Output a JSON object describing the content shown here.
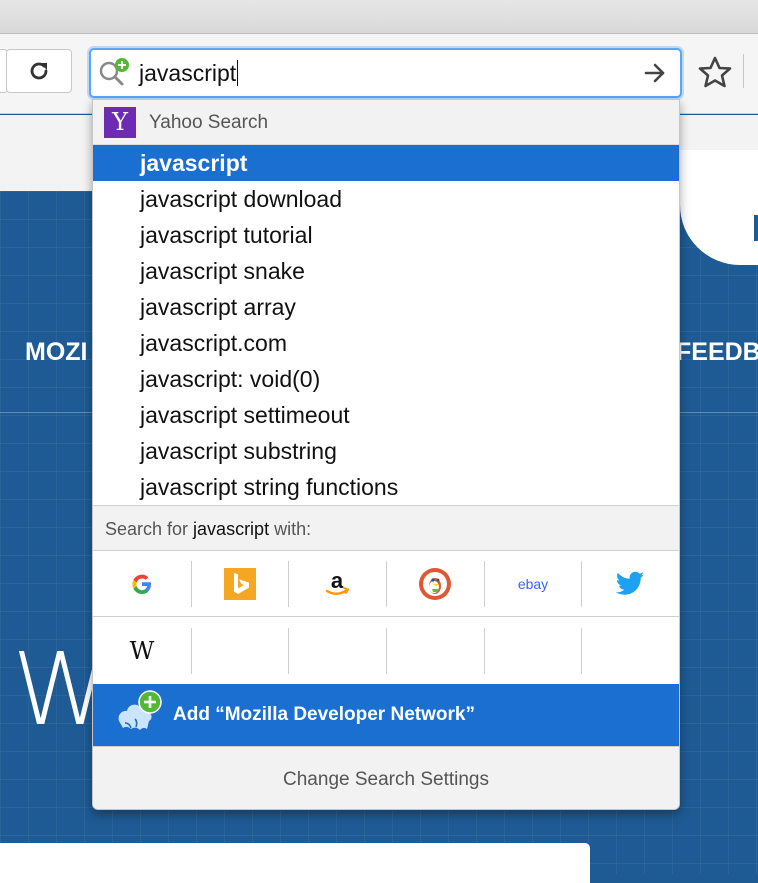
{
  "urlbar": {
    "value": "javascript"
  },
  "popup": {
    "engine_header": {
      "logo_text": "Y",
      "name": "Yahoo Search"
    },
    "suggestions": [
      "javascript",
      "javascript download",
      "javascript tutorial",
      "javascript snake",
      "javascript array",
      "javascript.com",
      "javascript: void(0)",
      "javascript settimeout",
      "javascript substring",
      "javascript string functions"
    ],
    "search_with": {
      "prefix": "Search for ",
      "query": "javascript",
      "suffix": " with:"
    },
    "one_off_engines": [
      "google-icon",
      "bing-icon",
      "amazon-icon",
      "duckduckgo-icon",
      "ebay-icon",
      "twitter-icon",
      "wikipedia-icon"
    ],
    "wikipedia_glyph": "W",
    "ebay_text": "ebay",
    "amazon_text": "a",
    "add_engine": {
      "label": "Add “Mozilla Developer Network”"
    },
    "change_settings": "Change Search Settings"
  },
  "page": {
    "nav_left": "MOZI",
    "nav_right": "FEEDBA",
    "big_letter": "W"
  },
  "colors": {
    "selection": "#1a6fd1",
    "page_blue": "#1e5a93",
    "yahoo_purple": "#6d2bb3",
    "focus_ring": "#5aa5f5"
  }
}
